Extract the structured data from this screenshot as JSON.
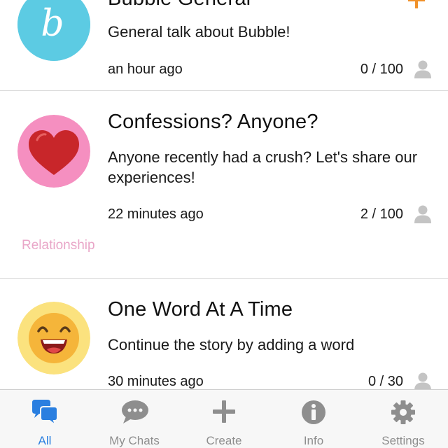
{
  "rooms": [
    {
      "title": "Bubble General",
      "description": "General talk about Bubble!",
      "time": "an hour ago",
      "count": "0 / 100",
      "avatar_icon": "bubble-logo-icon",
      "tag": ""
    },
    {
      "title": "Confessions? Anyone?",
      "description": "Anyone recently had a crush? Let's share our experiences!",
      "time": "22 minutes ago",
      "count": "2 / 100",
      "avatar_icon": "heart-icon",
      "tag": "Relationship"
    },
    {
      "title": "One Word At A Time",
      "description": "Continue the story by adding a word",
      "time": "30 minutes ago",
      "count": "0 / 30",
      "avatar_icon": "laughing-face-icon",
      "tag": ""
    }
  ],
  "tabbar": {
    "tabs": [
      {
        "label": "All",
        "icon": "chat-bubbles-icon",
        "active": true
      },
      {
        "label": "My Chats",
        "icon": "speech-bubble-icon",
        "active": false
      },
      {
        "label": "Create",
        "icon": "plus-icon",
        "active": false
      },
      {
        "label": "Info",
        "icon": "info-icon",
        "active": false
      },
      {
        "label": "Settings",
        "icon": "gear-icon",
        "active": false
      }
    ]
  },
  "colors": {
    "accent": "#2a7fe0",
    "inactive_tab": "#8e8e8e",
    "tag": "#e9a6c8",
    "add_icon": "#f0912a"
  }
}
